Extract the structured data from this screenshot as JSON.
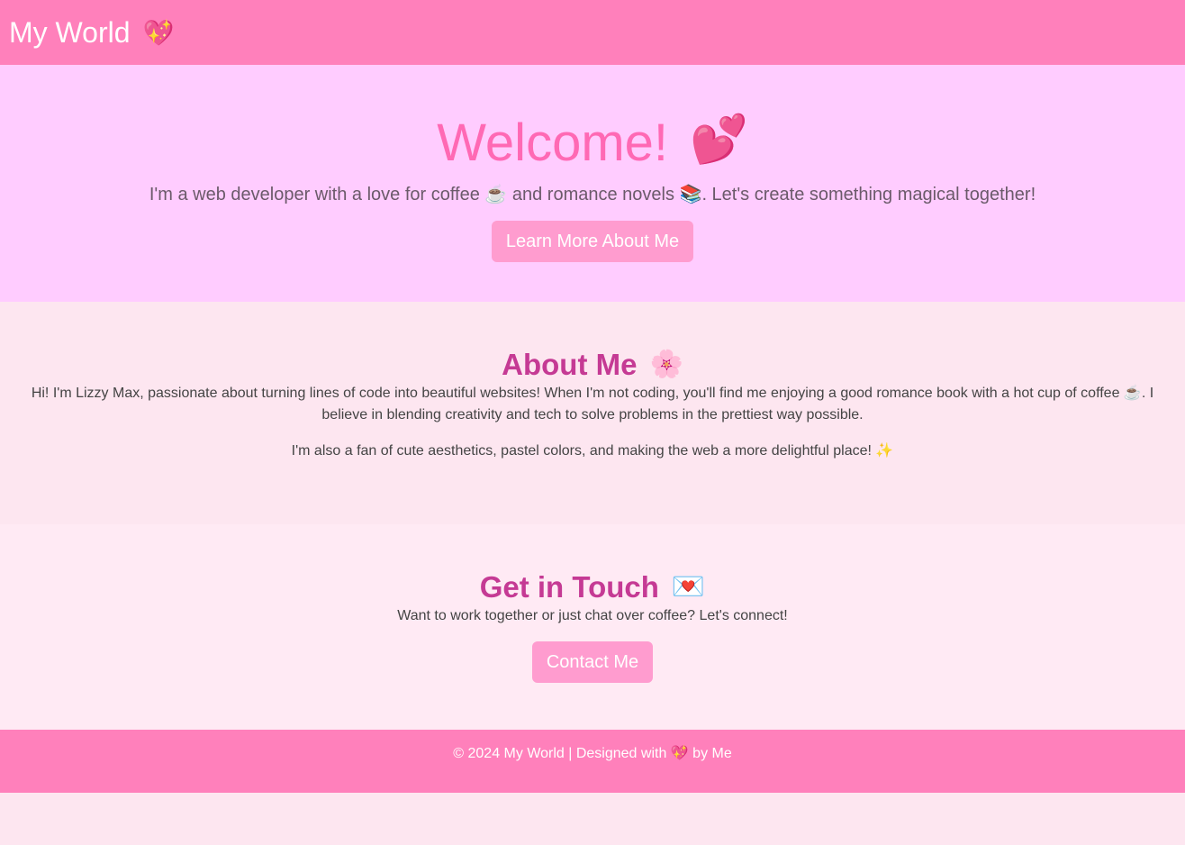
{
  "header": {
    "brand": "My World",
    "brand_emoji": "💖"
  },
  "hero": {
    "title": "Welcome!",
    "title_emoji": "💕",
    "subtitle": "I'm a web developer with a love for coffee ☕ and romance novels 📚. Let's create something magical together!",
    "button_label": "Learn More About Me"
  },
  "about": {
    "title": "About Me",
    "title_emoji": "🌸",
    "paragraph1": "Hi! I'm Lizzy Max, passionate about turning lines of code into beautiful websites! When I'm not coding, you'll find me enjoying a good romance book with a hot cup of coffee ☕. I believe in blending creativity and tech to solve problems in the prettiest way possible.",
    "paragraph2": "I'm also a fan of cute aesthetics, pastel colors, and making the web a more delightful place! ✨"
  },
  "contact": {
    "title": "Get in Touch",
    "title_emoji": "💌",
    "text": "Want to work together or just chat over coffee? Let's connect!",
    "button_label": "Contact Me"
  },
  "footer": {
    "text": "© 2024 My World | Designed with 💖 by Me"
  },
  "colors": {
    "header": "#ff80bb",
    "hero_bg": "#ffccff",
    "accent_title": "#ff69b4",
    "section_title": "#c53a94",
    "button": "#ff9ccf"
  }
}
